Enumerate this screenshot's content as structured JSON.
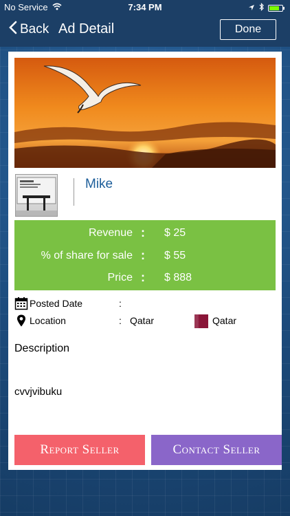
{
  "status_bar": {
    "carrier": "No Service",
    "time": "7:34 PM"
  },
  "navbar": {
    "back_label": "Back",
    "title": "Ad Detail",
    "done_label": "Done"
  },
  "seller": {
    "name": "Mike"
  },
  "stats": [
    {
      "label": "Revenue",
      "value": "$ 25"
    },
    {
      "label": "% of share for sale",
      "value": "$ 55"
    },
    {
      "label": "Price",
      "value": "$ 888"
    }
  ],
  "info": {
    "posted_date_label": "Posted Date",
    "posted_date_value": "",
    "location_label": "Location",
    "location_value": "Qatar",
    "country_label": "Qatar"
  },
  "description": {
    "heading": "Description",
    "text": "cvvjvibuku"
  },
  "buttons": {
    "report": "Report Seller",
    "contact": "Contact Seller"
  },
  "colors": {
    "stats_bg": "#7ac143",
    "report_bg": "#f4616b",
    "contact_bg": "#8a66c9",
    "seller_name": "#1d5e9a"
  }
}
